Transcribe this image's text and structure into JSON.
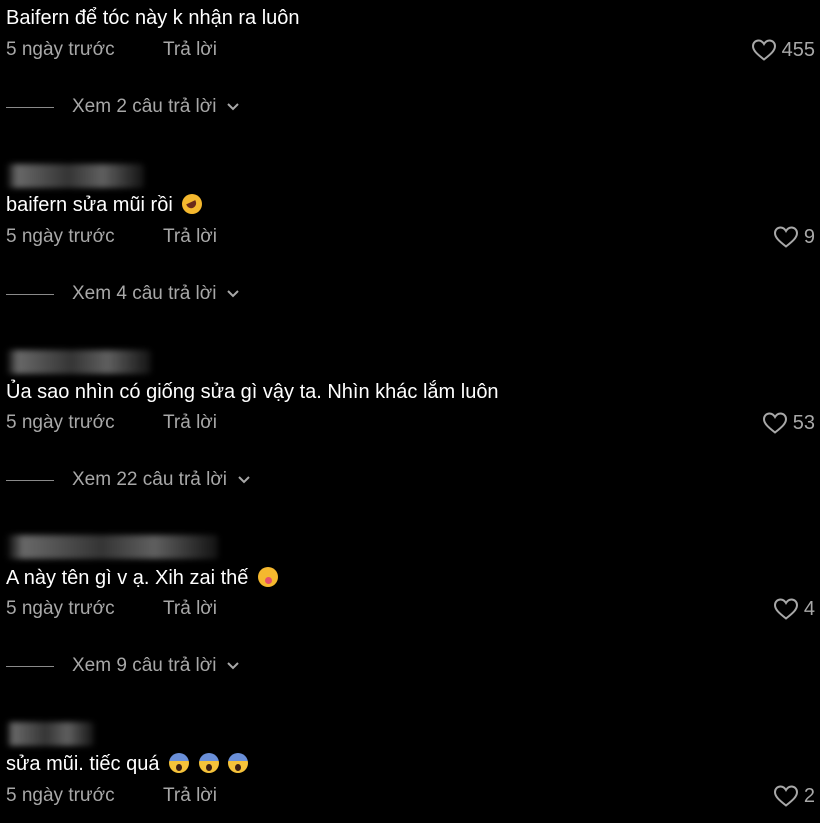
{
  "comments": [
    {
      "text": "Baifern để tóc này k nhận ra luôn",
      "emojis": [],
      "time": "5 ngày trước",
      "reply": "Trả lời",
      "likes": "455",
      "view_replies": "Xem 2 câu trả lời"
    },
    {
      "text": "baifern sửa mũi rồi",
      "emojis": [
        "rolling-on-floor-laughing"
      ],
      "time": "5 ngày trước",
      "reply": "Trả lời",
      "likes": "9",
      "view_replies": "Xem 4 câu trả lời"
    },
    {
      "text": "Ủa sao nhìn có giống sửa gì vậy ta. Nhìn khác lắm luôn",
      "emojis": [],
      "time": "5 ngày trước",
      "reply": "Trả lời",
      "likes": "53",
      "view_replies": "Xem 22 câu trả lời"
    },
    {
      "text": "A này tên gì v ạ. Xih zai thế",
      "emojis": [
        "hushed-face"
      ],
      "time": "5 ngày trước",
      "reply": "Trả lời",
      "likes": "4",
      "view_replies": "Xem 9 câu trả lời"
    },
    {
      "text": "sửa mũi. tiếc quá",
      "emojis": [
        "screaming-face",
        "screaming-face",
        "screaming-face"
      ],
      "time": "5 ngày trước",
      "reply": "Trả lời",
      "likes": "2",
      "view_replies": ""
    }
  ],
  "colors": {
    "background": "#000000",
    "text": "#ffffff",
    "secondary": "#a8a8a8"
  },
  "icons": {
    "like": "heart-outline-icon",
    "expand": "chevron-down-icon"
  }
}
